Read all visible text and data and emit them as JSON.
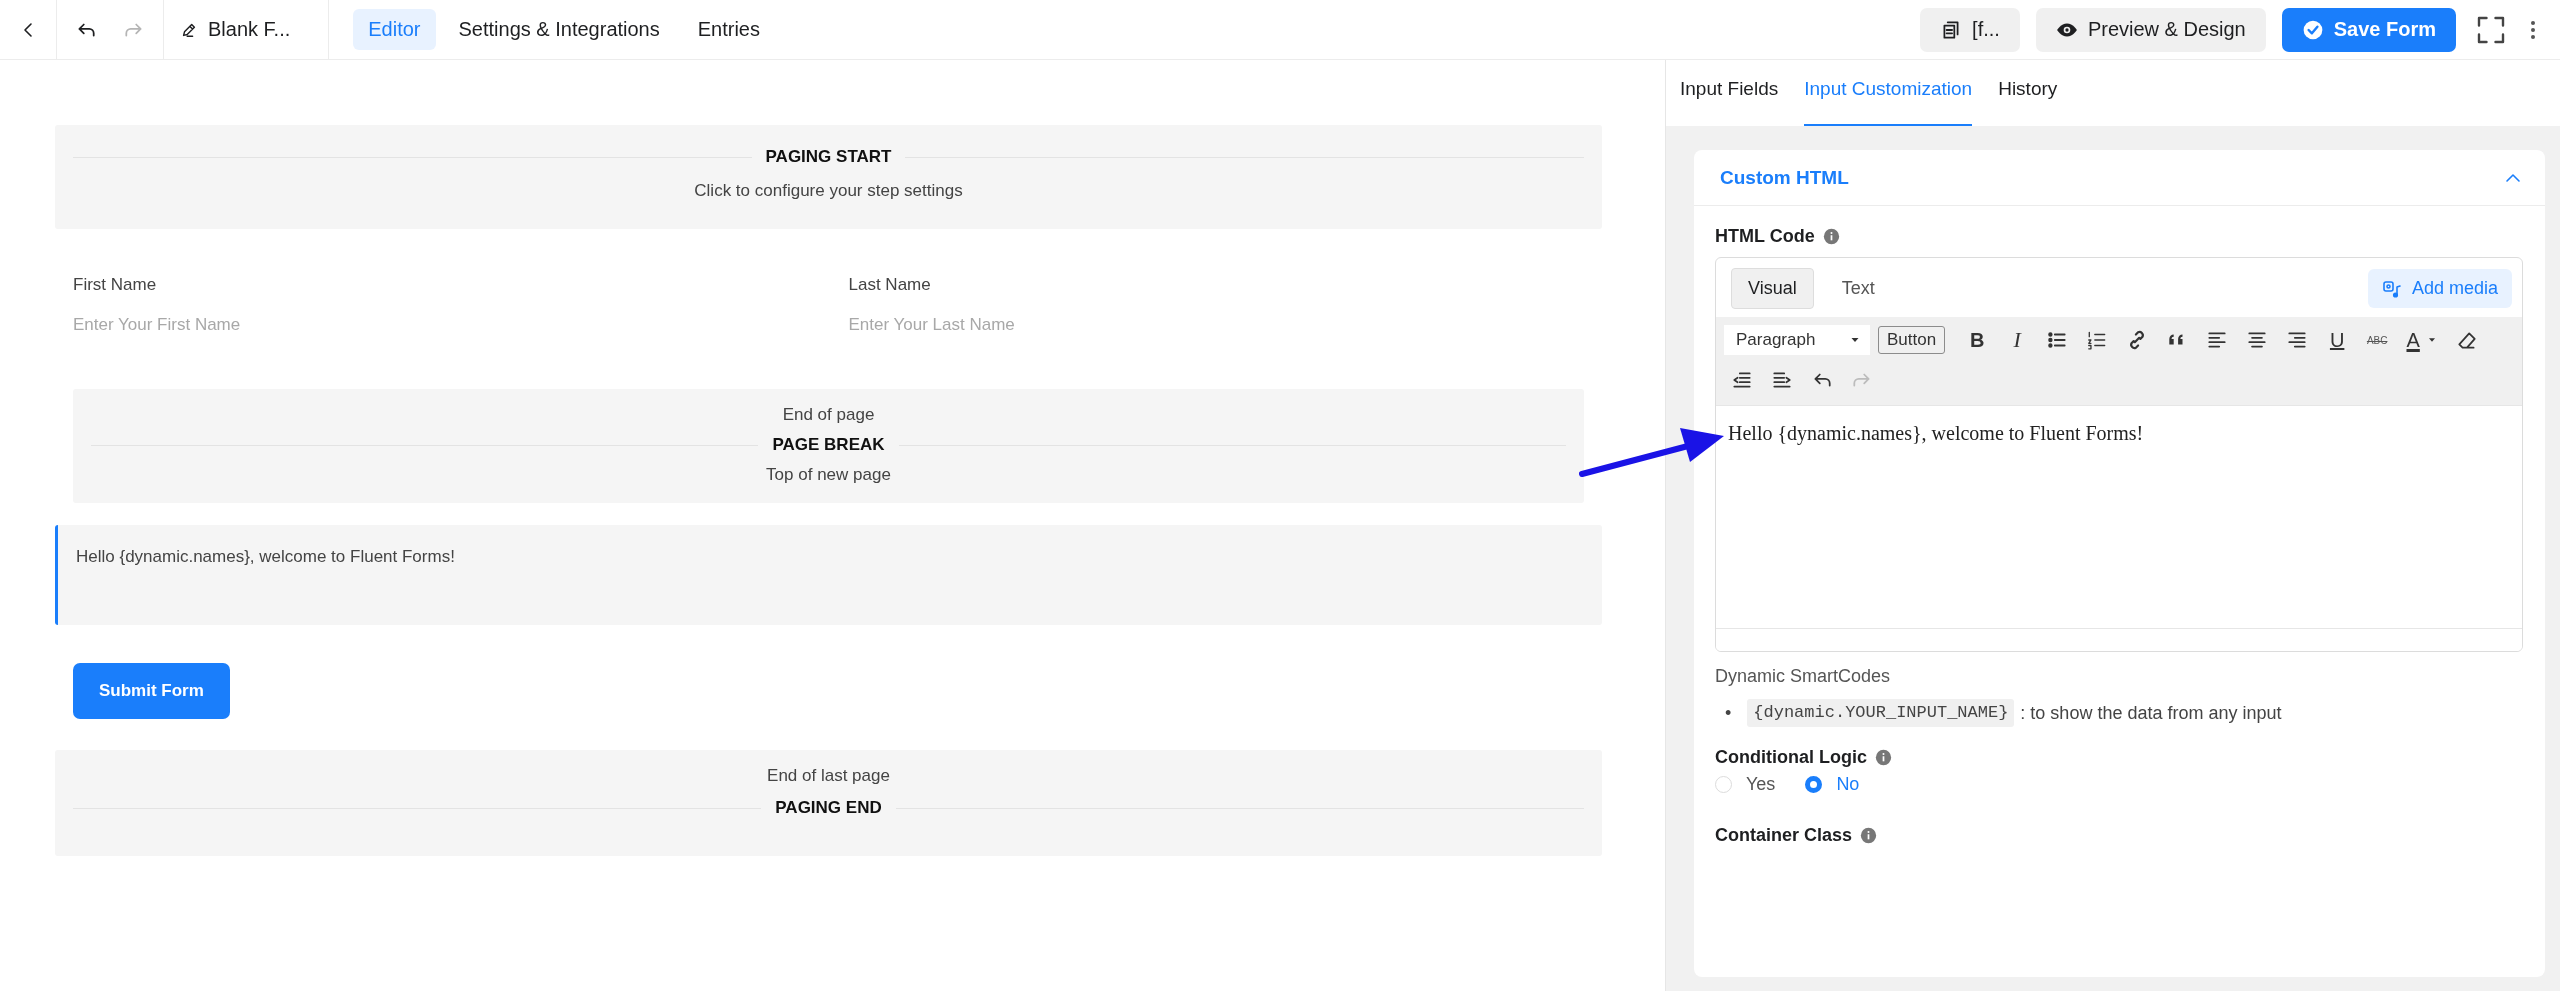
{
  "topbar": {
    "history": [
      {
        "kind": "undo",
        "disabled": false
      },
      {
        "kind": "redo",
        "disabled": true
      }
    ],
    "form_title": "Blank F...",
    "tabs": [
      {
        "label": "Editor",
        "selected": true
      },
      {
        "label": "Settings & Integrations",
        "selected": false
      },
      {
        "label": "Entries",
        "selected": false
      }
    ],
    "actions": [
      {
        "kind": "shortcode",
        "label": "[f..."
      },
      {
        "kind": "preview",
        "label": "Preview & Design"
      },
      {
        "kind": "save",
        "label": "Save Form"
      }
    ]
  },
  "canvas": {
    "items": [
      {
        "kind": "paging_start",
        "title": "PAGING START",
        "subtitle": "Click to configure your step settings"
      },
      {
        "kind": "name_fields",
        "fields": [
          {
            "label": "First Name",
            "placeholder": "Enter Your First Name"
          },
          {
            "label": "Last Name",
            "placeholder": "Enter Your Last Name"
          }
        ]
      },
      {
        "kind": "page_break",
        "above": "End of page",
        "title": "PAGE BREAK",
        "below": "Top of new page"
      },
      {
        "kind": "custom_html",
        "text": "Hello {dynamic.names}, welcome to Fluent Forms!",
        "selected": true
      },
      {
        "kind": "submit",
        "label": "Submit Form"
      },
      {
        "kind": "paging_end",
        "above": "End of last page",
        "title": "PAGING END"
      }
    ]
  },
  "panel": {
    "tabs": [
      {
        "label": "Input Fields",
        "selected": false
      },
      {
        "label": "Input Customization",
        "selected": true
      },
      {
        "label": "History",
        "selected": false
      }
    ],
    "section": {
      "title": "Custom HTML",
      "expanded": true
    },
    "html_code": {
      "label": "HTML Code",
      "editor_tabs": [
        {
          "label": "Visual",
          "selected": true
        },
        {
          "label": "Text",
          "selected": false
        }
      ],
      "add_media": "Add media",
      "format": "Paragraph",
      "button_label": "Button",
      "tools": [
        {
          "kind": "bold",
          "glyph": "B",
          "disabled": false
        },
        {
          "kind": "italic",
          "glyph": "I",
          "disabled": false
        },
        {
          "kind": "bullet_list",
          "disabled": false
        },
        {
          "kind": "number_list",
          "disabled": false
        },
        {
          "kind": "link",
          "disabled": false
        },
        {
          "kind": "quote",
          "disabled": false
        },
        {
          "kind": "align_left",
          "disabled": false
        },
        {
          "kind": "align_center",
          "disabled": false
        },
        {
          "kind": "align_right",
          "disabled": false
        },
        {
          "kind": "underline",
          "glyph": "U",
          "disabled": false
        },
        {
          "kind": "strike",
          "glyph": "ABC",
          "disabled": false
        },
        {
          "kind": "text_color",
          "glyph": "A",
          "disabled": false
        },
        {
          "kind": "eraser",
          "disabled": false
        },
        {
          "kind": "outdent",
          "disabled": false
        },
        {
          "kind": "indent",
          "disabled": false
        },
        {
          "kind": "undo",
          "disabled": false
        },
        {
          "kind": "redo",
          "disabled": true
        }
      ],
      "content": "Hello {dynamic.names}, welcome to Fluent Forms!"
    },
    "smartcodes": {
      "title": "Dynamic SmartCodes",
      "items": [
        {
          "marker": "•",
          "code": "{dynamic.YOUR_INPUT_NAME}",
          "description": ": to show the data from any input"
        }
      ]
    },
    "conditional_logic": {
      "label": "Conditional Logic",
      "options": [
        {
          "label": "Yes",
          "selected": false
        },
        {
          "label": "No",
          "selected": true
        }
      ]
    },
    "container_class": {
      "label": "Container Class"
    }
  }
}
